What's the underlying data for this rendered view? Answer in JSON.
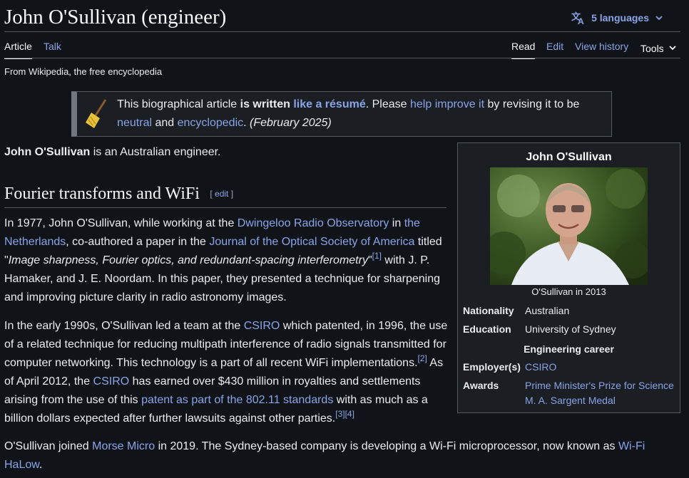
{
  "page": {
    "title": "John O'Sullivan (engineer)",
    "languages": "5 languages"
  },
  "tabs": {
    "article": "Article",
    "talk": "Talk",
    "read": "Read",
    "edit": "Edit",
    "view_history": "View history",
    "tools": "Tools"
  },
  "tagline": "From Wikipedia, the free encyclopedia",
  "notice": {
    "t1": "This biographical article ",
    "t2": "is written",
    "t3": " ",
    "t4": "like a résumé",
    "t5": ". Please ",
    "t6": "help improve it",
    "t7": " by revising it to be ",
    "t8": "neutral",
    "t9": " and ",
    "t10": "encyclopedic",
    "t11": ". ",
    "t12": "(February 2025)"
  },
  "lead": {
    "name": "John O'Sullivan",
    "rest": " is an Australian engineer."
  },
  "section": {
    "heading": "Fourier transforms and WiFi",
    "edit_open": "[ ",
    "edit_label": "edit",
    "edit_close": " ]"
  },
  "p1": {
    "a": "In 1977, John O'Sullivan, while working at the ",
    "l1": "Dwingeloo Radio Observatory",
    "b": " in ",
    "l2": "the Netherlands",
    "c": ", co-authored a paper in the ",
    "l3": "Journal of the Optical Society of America",
    "d": " titled \"",
    "e": "Image sharpness, Fourier optics, and redundant-spacing interferometry",
    "f": "\"",
    "ref1": "[1]",
    "g": " with J. P. Hamaker, and J. E. Noordam. In this paper, they presented a technique for sharpening and improving picture clarity in radio astronomy images."
  },
  "p2": {
    "a": "In the early 1990s, O'Sullivan led a team at the ",
    "l1": "CSIRO",
    "b": " which patented, in 1996, the use of a related technique for reducing multipath interference of radio signals transmitted for computer networking. This technology is a part of all recent WiFi implementations.",
    "ref2": "[2]",
    "c": " As of April 2012, the ",
    "l2": "CSIRO",
    "d": " has earned over $430 million in royalties and settlements arising from the use of this ",
    "l3": "patent as part of the 802.11 standards",
    "e": " with as much as a billion dollars expected after further lawsuits against other parties.",
    "ref3": "[3]",
    "ref4": "[4]"
  },
  "p3": {
    "a": "O'Sullivan joined ",
    "l1": "Morse Micro",
    "b": " in 2019. The Sydney-based company is developing a Wi-Fi microprocessor, now known as ",
    "l2": "Wi-Fi HaLow",
    "c": "."
  },
  "infobox": {
    "name": "John O'Sullivan",
    "caption": "O'Sullivan in 2013",
    "nationality_label": "Nationality",
    "nationality": "Australian",
    "education_label": "Education",
    "education": "University of Sydney",
    "career_header": "Engineering career",
    "employer_label": "Employer(s)",
    "employer": "CSIRO",
    "awards_label": "Awards",
    "award1": "Prime Minister's Prize for Science",
    "award2": "M. A. Sargent Medal"
  },
  "icons": {
    "language": "translate-icon",
    "chevron": "chevron-down-icon",
    "broom": "broom-icon"
  },
  "colors": {
    "background": "#101418",
    "link": "#88a3e8",
    "text": "#eaecf0",
    "border": "#54595d"
  }
}
